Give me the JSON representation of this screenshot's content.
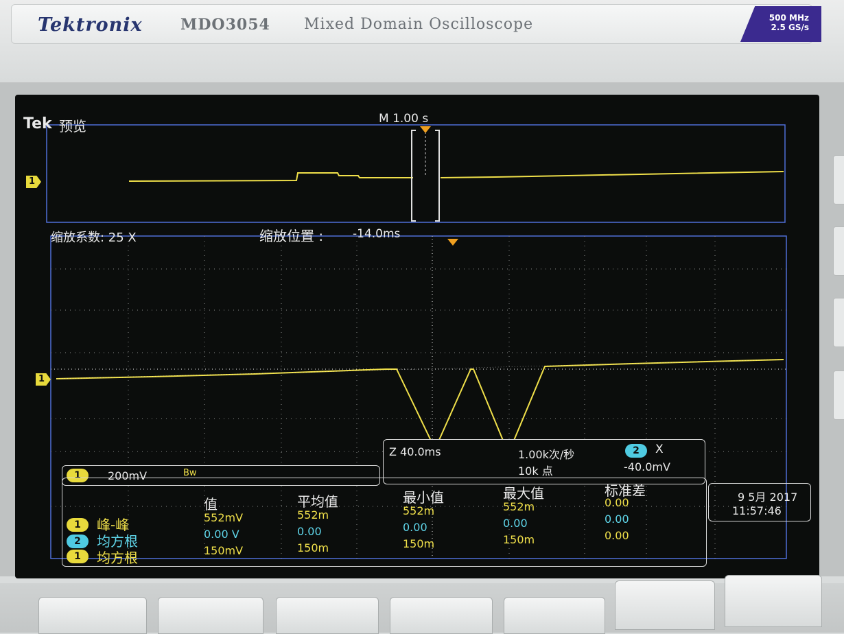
{
  "header": {
    "brand": "Tektronix",
    "model": "MDO3054",
    "model_desc": "Mixed Domain Oscilloscope",
    "spec_bandwidth": "500 MHz",
    "spec_samplerate": "2.5 GS/s"
  },
  "screen": {
    "logo": "Tek",
    "mode": "预览",
    "main_timebase": "M 1.00 s",
    "zoom_factor": "缩放系数: 25 X",
    "zoom_position_label": "缩放位置 :",
    "zoom_position_value": "-14.0ms",
    "channel_marker": "1",
    "zoom_panel": {
      "zoom_scale": "Z 40.0ms",
      "rate": "1.00k次/秒",
      "points": "10k 点",
      "cursor_channel": "2",
      "cursor_label": "X",
      "cursor_value": "-40.0mV"
    },
    "channel_setting": {
      "channel": "1",
      "scale": "200mV",
      "bandwidth_icon": "bandwidth-limit-icon"
    },
    "measurements": {
      "headers": [
        "值",
        "平均值",
        "最小值",
        "最大值",
        "标准差"
      ],
      "rows": [
        {
          "channel": "1",
          "name": "峰-峰",
          "values": [
            "552mV",
            "552m",
            "552m",
            "552m",
            "0.00"
          ]
        },
        {
          "channel": "2",
          "name": "均方根",
          "values": [
            "0.00 V",
            "0.00",
            "0.00",
            "0.00",
            "0.00"
          ]
        },
        {
          "channel": "1",
          "name": "均方根",
          "values": [
            "150mV",
            "150m",
            "150m",
            "150m",
            "0.00"
          ]
        }
      ]
    },
    "datetime": {
      "date": "9 5月 2017",
      "time": "11:57:46"
    }
  },
  "colors": {
    "ch1": "#f0e04a",
    "ch2": "#5fd6ea",
    "graticule_border": "#4f6fd8",
    "trigger": "#f0a020"
  }
}
